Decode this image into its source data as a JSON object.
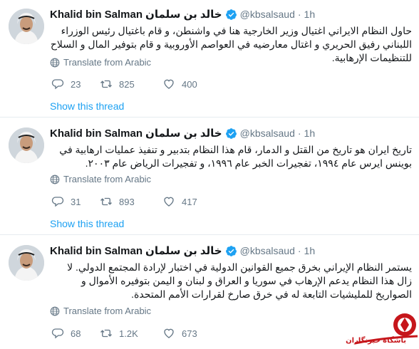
{
  "tweets": [
    {
      "name": "Khalid bin Salman",
      "arabic_name": "خالد بن سلمان",
      "handle": "@kbsalsaud",
      "time": "1h",
      "text": "حاول النظام الايراني اغتيال وزير الخارجية هنا في واشنطن، و قام باغتيال رئيس الوزراء اللبناني رفيق الحريري و اغتال معارضيه في العواصم الأوروبية و قام بتوفير المال و السلاح للتنظيمات الإرهابية.",
      "translate_label": "Translate from Arabic",
      "replies": "23",
      "retweets": "825",
      "likes": "400",
      "show_thread": "Show this thread"
    },
    {
      "name": "Khalid bin Salman",
      "arabic_name": "خالد بن سلمان",
      "handle": "@kbsalsaud",
      "time": "1h",
      "text": "تاريخ ايران هو تاريخ من القتل و الدمار، قام هذا النظام بتدبير و تنفيذ عمليات ارهابية في بوينس ايرس عام ١٩٩٤، تفجيرات الخبر عام ١٩٩٦، و تفجيرات الرياض عام ٢٠٠٣.",
      "translate_label": "Translate from Arabic",
      "replies": "31",
      "retweets": "893",
      "likes": "417",
      "show_thread": "Show this thread"
    },
    {
      "name": "Khalid bin Salman",
      "arabic_name": "خالد بن سلمان",
      "handle": "@kbsalsaud",
      "time": "1h",
      "text": "يستمر النظام الإيراني بخرق جميع القوانين الدولية في اختبار لإرادة المجتمع الدولي. لا زال هذا النظام يدعم الإرهاب في سوريا و العراق و لبنان و اليمن بتوفيره الأموال و الصواريخ للمليشيات التابعة له في خرق صارخ لقرارات الأمم المتحدة.",
      "translate_label": "Translate from Arabic",
      "replies": "68",
      "retweets": "1.2K",
      "likes": "673"
    }
  ],
  "watermark": {
    "text": "باشگاه خبرنگاران",
    "color": "#c6161b"
  },
  "colors": {
    "link": "#1da1f2",
    "muted": "#657786",
    "verified": "#1da1f2"
  },
  "icons": [
    "avatar",
    "verified-badge-icon",
    "globe-icon",
    "reply-icon",
    "retweet-icon",
    "like-icon"
  ]
}
